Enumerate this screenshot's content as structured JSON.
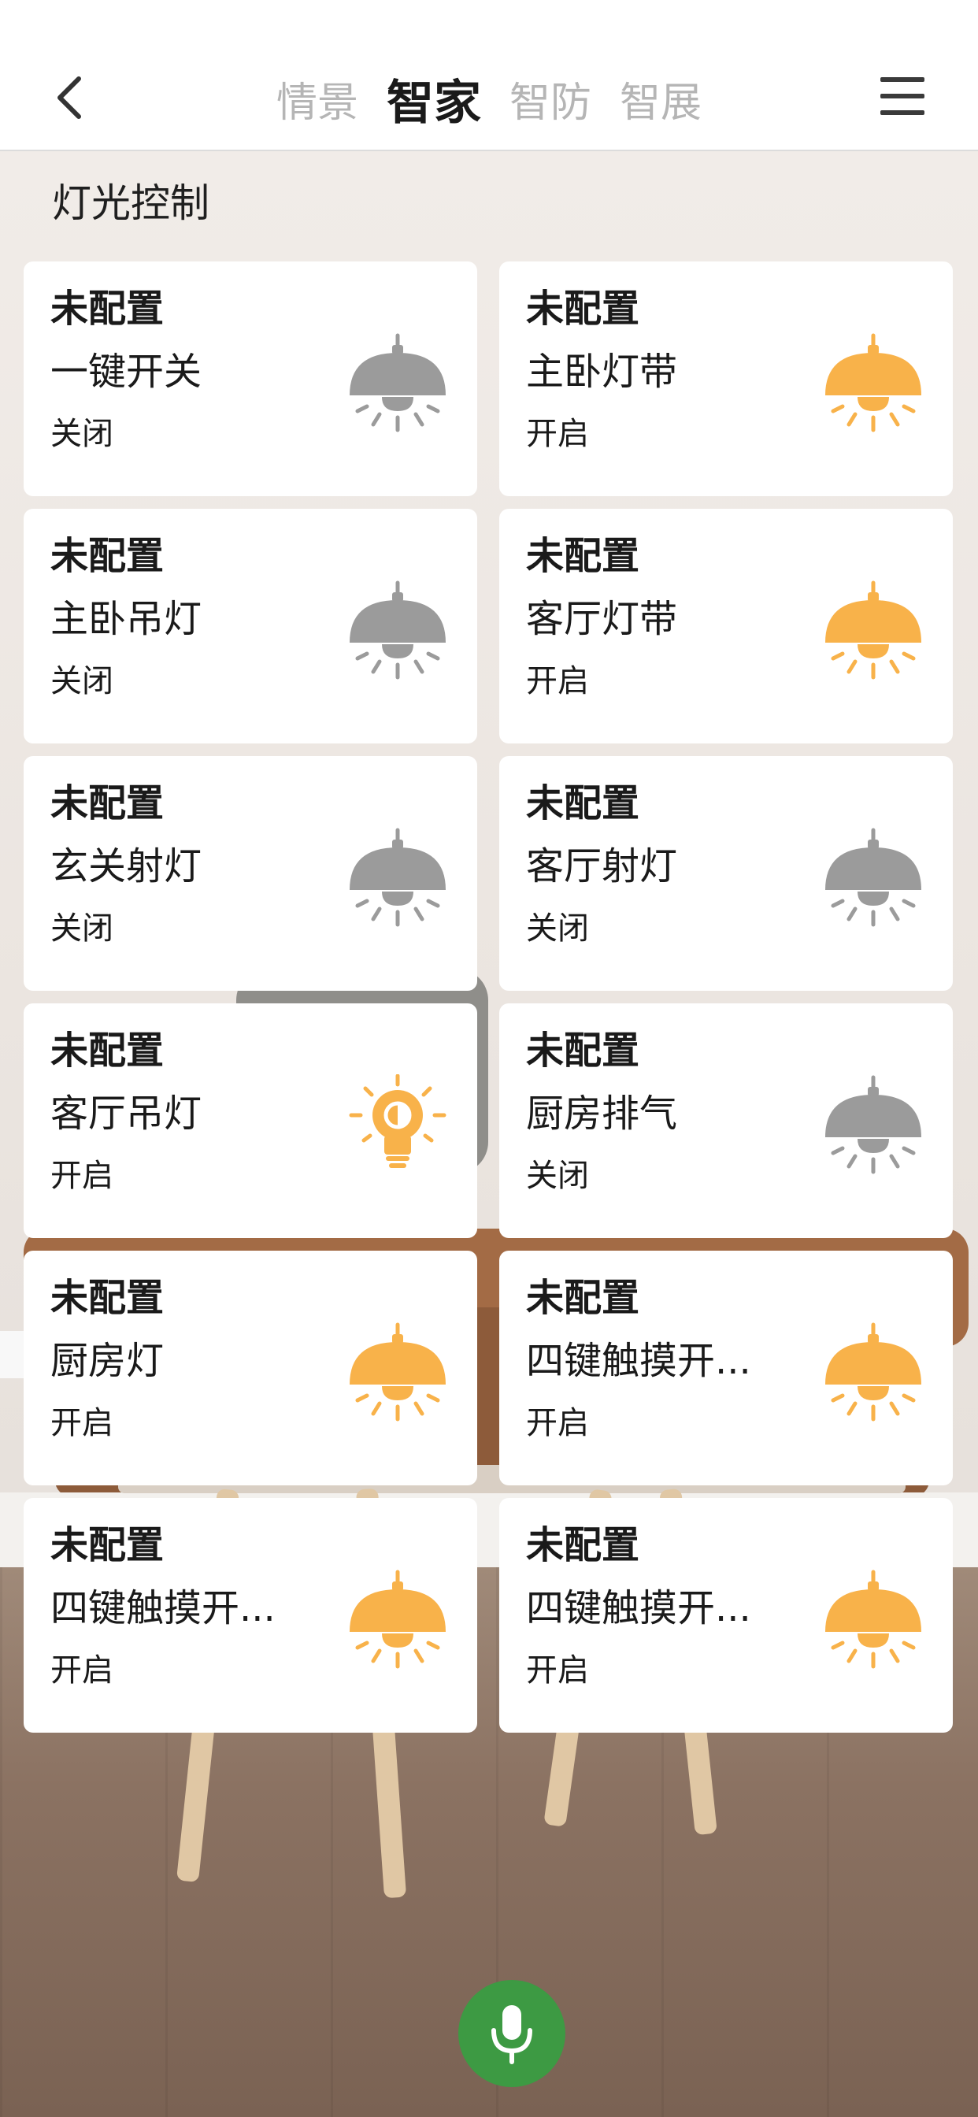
{
  "header": {
    "tabs": [
      {
        "label": "情景",
        "active": false
      },
      {
        "label": "智家",
        "active": true
      },
      {
        "label": "智防",
        "active": false
      },
      {
        "label": "智展",
        "active": false
      }
    ]
  },
  "section": {
    "title": "灯光控制"
  },
  "devices": [
    {
      "status": "未配置",
      "name": "一键开关",
      "state": "关闭",
      "icon": "pendant-lamp-icon",
      "on": false
    },
    {
      "status": "未配置",
      "name": "主卧灯带",
      "state": "开启",
      "icon": "pendant-lamp-icon",
      "on": true
    },
    {
      "status": "未配置",
      "name": "主卧吊灯",
      "state": "关闭",
      "icon": "pendant-lamp-icon",
      "on": false
    },
    {
      "status": "未配置",
      "name": "客厅灯带",
      "state": "开启",
      "icon": "pendant-lamp-icon",
      "on": true
    },
    {
      "status": "未配置",
      "name": "玄关射灯",
      "state": "关闭",
      "icon": "pendant-lamp-icon",
      "on": false
    },
    {
      "status": "未配置",
      "name": "客厅射灯",
      "state": "关闭",
      "icon": "pendant-lamp-icon",
      "on": false
    },
    {
      "status": "未配置",
      "name": "客厅吊灯",
      "state": "开启",
      "icon": "light-bulb-icon",
      "on": true
    },
    {
      "status": "未配置",
      "name": "厨房排气",
      "state": "关闭",
      "icon": "pendant-lamp-icon",
      "on": false
    },
    {
      "status": "未配置",
      "name": "厨房灯",
      "state": "开启",
      "icon": "pendant-lamp-icon",
      "on": true
    },
    {
      "status": "未配置",
      "name": "四键触摸开...",
      "state": "开启",
      "icon": "pendant-lamp-icon",
      "on": true
    },
    {
      "status": "未配置",
      "name": "四键触摸开...",
      "state": "开启",
      "icon": "pendant-lamp-icon",
      "on": true
    },
    {
      "status": "未配置",
      "name": "四键触摸开...",
      "state": "开启",
      "icon": "pendant-lamp-icon",
      "on": true
    }
  ],
  "colors": {
    "on": "#f8b24a",
    "off": "#9b9b9b",
    "mic": "#3d9a43"
  }
}
